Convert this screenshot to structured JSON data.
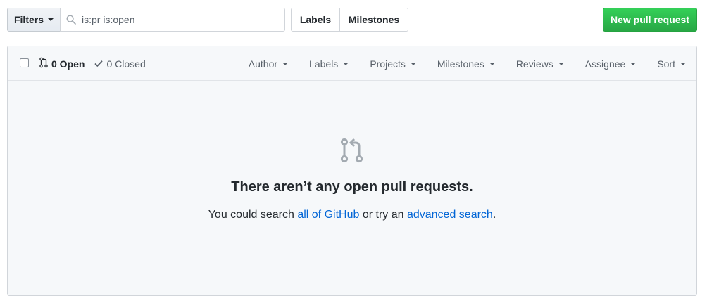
{
  "toolbar": {
    "filters_label": "Filters",
    "search_value": "is:pr is:open",
    "labels_tab": "Labels",
    "milestones_tab": "Milestones",
    "new_button": "New pull request"
  },
  "list_header": {
    "open_label": "0 Open",
    "closed_label": "0 Closed",
    "filters": [
      "Author",
      "Labels",
      "Projects",
      "Milestones",
      "Reviews",
      "Assignee",
      "Sort"
    ]
  },
  "blankslate": {
    "icon": "git-pull-request-icon",
    "title": "There aren’t any open pull requests.",
    "text_prefix": "You could search ",
    "link_all": "all of GitHub",
    "text_middle": " or try an ",
    "link_advanced": "advanced search",
    "text_suffix": "."
  },
  "colors": {
    "primary_green": "#2ea44f",
    "link_blue": "#0366d6",
    "header_bg": "#f6f8fa",
    "icon_gray": "#a3aab1"
  }
}
